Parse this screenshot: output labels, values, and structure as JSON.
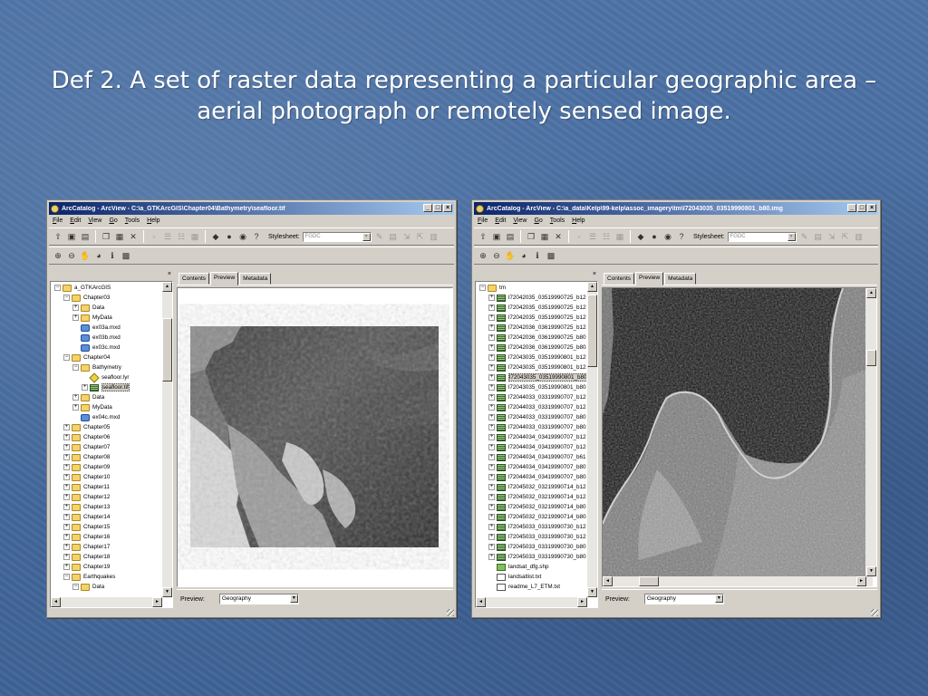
{
  "slide": {
    "title_line1": "Def 2. A set of raster data representing a particular geographic area –",
    "title_line2": "aerial photograph or remotely sensed image."
  },
  "window_left": {
    "title": "ArcCatalog - ArcView - C:\\a_GTKArcGIS\\Chapter04\\Bathymetry\\seafloor.tif",
    "menu": [
      "File",
      "Edit",
      "View",
      "Go",
      "Tools",
      "Help"
    ],
    "stylesheet_label": "Stylesheet:",
    "stylesheet_value": "FGDC",
    "tabs": [
      "Contents",
      "Preview",
      "Metadata"
    ],
    "active_tab": "Preview",
    "preview_label": "Preview:",
    "preview_value": "Geography",
    "tree": [
      {
        "label": "a_GTKArcGIS",
        "depth": 0,
        "pm": "−",
        "icon": "folder"
      },
      {
        "label": "Chapter03",
        "depth": 1,
        "pm": "−",
        "icon": "folder"
      },
      {
        "label": "Data",
        "depth": 2,
        "pm": "+",
        "icon": "folder"
      },
      {
        "label": "MyData",
        "depth": 2,
        "pm": "+",
        "icon": "folder"
      },
      {
        "label": "ex03a.mxd",
        "depth": 2,
        "pm": "",
        "icon": "mxd"
      },
      {
        "label": "ex03b.mxd",
        "depth": 2,
        "pm": "",
        "icon": "mxd"
      },
      {
        "label": "ex03c.mxd",
        "depth": 2,
        "pm": "",
        "icon": "mxd"
      },
      {
        "label": "Chapter04",
        "depth": 1,
        "pm": "−",
        "icon": "folder"
      },
      {
        "label": "Bathymetry",
        "depth": 2,
        "pm": "−",
        "icon": "folder"
      },
      {
        "label": "seafloor.lyr",
        "depth": 3,
        "pm": "",
        "icon": "lyr"
      },
      {
        "label": "seafloor.tif",
        "depth": 3,
        "pm": "+",
        "icon": "grid",
        "selected": true
      },
      {
        "label": "Data",
        "depth": 2,
        "pm": "+",
        "icon": "folder"
      },
      {
        "label": "MyData",
        "depth": 2,
        "pm": "+",
        "icon": "folder"
      },
      {
        "label": "ex04c.mxd",
        "depth": 2,
        "pm": "",
        "icon": "mxd"
      },
      {
        "label": "Chapter05",
        "depth": 1,
        "pm": "+",
        "icon": "folder"
      },
      {
        "label": "Chapter06",
        "depth": 1,
        "pm": "+",
        "icon": "folder"
      },
      {
        "label": "Chapter07",
        "depth": 1,
        "pm": "+",
        "icon": "folder"
      },
      {
        "label": "Chapter08",
        "depth": 1,
        "pm": "+",
        "icon": "folder"
      },
      {
        "label": "Chapter09",
        "depth": 1,
        "pm": "+",
        "icon": "folder"
      },
      {
        "label": "Chapter10",
        "depth": 1,
        "pm": "+",
        "icon": "folder"
      },
      {
        "label": "Chapter11",
        "depth": 1,
        "pm": "+",
        "icon": "folder"
      },
      {
        "label": "Chapter12",
        "depth": 1,
        "pm": "+",
        "icon": "folder"
      },
      {
        "label": "Chapter13",
        "depth": 1,
        "pm": "+",
        "icon": "folder"
      },
      {
        "label": "Chapter14",
        "depth": 1,
        "pm": "+",
        "icon": "folder"
      },
      {
        "label": "Chapter15",
        "depth": 1,
        "pm": "+",
        "icon": "folder"
      },
      {
        "label": "Chapter16",
        "depth": 1,
        "pm": "+",
        "icon": "folder"
      },
      {
        "label": "Chapter17",
        "depth": 1,
        "pm": "+",
        "icon": "folder"
      },
      {
        "label": "Chapter18",
        "depth": 1,
        "pm": "+",
        "icon": "folder"
      },
      {
        "label": "Chapter19",
        "depth": 1,
        "pm": "+",
        "icon": "folder"
      },
      {
        "label": "Earthquakes",
        "depth": 1,
        "pm": "−",
        "icon": "folder"
      },
      {
        "label": "Data",
        "depth": 2,
        "pm": "−",
        "icon": "folder"
      }
    ]
  },
  "window_right": {
    "title": "ArcCatalog - ArcView - C:\\a_data\\Kelp\\99-kelp\\assoc_imagery\\tm\\l72043035_03519990801_b80.img",
    "menu": [
      "File",
      "Edit",
      "View",
      "Go",
      "Tools",
      "Help"
    ],
    "stylesheet_label": "Stylesheet:",
    "stylesheet_value": "FGDC",
    "tabs": [
      "Contents",
      "Preview",
      "Metadata"
    ],
    "active_tab": "Preview",
    "preview_label": "Preview:",
    "preview_value": "Geography",
    "tree": [
      {
        "label": "tm",
        "depth": 0,
        "pm": "−",
        "icon": "folder"
      },
      {
        "label": "l72042035_03519990725_b123",
        "depth": 1,
        "pm": "+",
        "icon": "grid"
      },
      {
        "label": "l72042035_03519990725_b123",
        "depth": 1,
        "pm": "+",
        "icon": "grid"
      },
      {
        "label": "l72042035_03519990725_b123",
        "depth": 1,
        "pm": "+",
        "icon": "grid"
      },
      {
        "label": "l72042036_03619990725_b123",
        "depth": 1,
        "pm": "+",
        "icon": "grid"
      },
      {
        "label": "l72042036_03619990725_b80.ii",
        "depth": 1,
        "pm": "+",
        "icon": "grid"
      },
      {
        "label": "l72042036_03619990725_b80a.",
        "depth": 1,
        "pm": "+",
        "icon": "grid"
      },
      {
        "label": "l72043035_03519990801_b123",
        "depth": 1,
        "pm": "+",
        "icon": "grid"
      },
      {
        "label": "l72043035_03519990801_b123",
        "depth": 1,
        "pm": "+",
        "icon": "grid"
      },
      {
        "label": "l72043035_03519990801_b80.ii",
        "depth": 1,
        "pm": "+",
        "icon": "grid",
        "selected": true
      },
      {
        "label": "l72043035_03519990801_b80a.",
        "depth": 1,
        "pm": "+",
        "icon": "grid"
      },
      {
        "label": "l72044033_03319990707_b123",
        "depth": 1,
        "pm": "+",
        "icon": "grid"
      },
      {
        "label": "l72044033_03319990707_b123",
        "depth": 1,
        "pm": "+",
        "icon": "grid"
      },
      {
        "label": "l72044033_03319990707_b80.ii",
        "depth": 1,
        "pm": "+",
        "icon": "grid"
      },
      {
        "label": "l72044033_03319990707_b80a.",
        "depth": 1,
        "pm": "+",
        "icon": "grid"
      },
      {
        "label": "l72044034_03419990707_b123",
        "depth": 1,
        "pm": "+",
        "icon": "grid"
      },
      {
        "label": "l72044034_03419990707_b123",
        "depth": 1,
        "pm": "+",
        "icon": "grid"
      },
      {
        "label": "l72044034_03419990707_b61.ii",
        "depth": 1,
        "pm": "+",
        "icon": "grid"
      },
      {
        "label": "l72044034_03419990707_b80.ii",
        "depth": 1,
        "pm": "+",
        "icon": "grid"
      },
      {
        "label": "l72044034_03419990707_b80a.",
        "depth": 1,
        "pm": "+",
        "icon": "grid"
      },
      {
        "label": "l72045032_03219990714_b123",
        "depth": 1,
        "pm": "+",
        "icon": "grid"
      },
      {
        "label": "l72045032_03219990714_b123",
        "depth": 1,
        "pm": "+",
        "icon": "grid"
      },
      {
        "label": "l72045032_03219990714_b80.ii",
        "depth": 1,
        "pm": "+",
        "icon": "grid"
      },
      {
        "label": "l72045032_03219990714_b80a.",
        "depth": 1,
        "pm": "+",
        "icon": "grid"
      },
      {
        "label": "l72045033_03319990730_b123",
        "depth": 1,
        "pm": "+",
        "icon": "grid"
      },
      {
        "label": "l72045033_03319990730_b123",
        "depth": 1,
        "pm": "+",
        "icon": "grid"
      },
      {
        "label": "l72045033_03319990730_b80.ii",
        "depth": 1,
        "pm": "+",
        "icon": "grid"
      },
      {
        "label": "l72045033_03319990730_b80a.",
        "depth": 1,
        "pm": "+",
        "icon": "grid"
      },
      {
        "label": "landsat_dfg.shp",
        "depth": 1,
        "pm": "",
        "icon": "shp"
      },
      {
        "label": "landsatlist.txt",
        "depth": 1,
        "pm": "",
        "icon": "txt"
      },
      {
        "label": "readme_L7_ETM.txt",
        "depth": 1,
        "pm": "",
        "icon": "txt"
      }
    ]
  }
}
